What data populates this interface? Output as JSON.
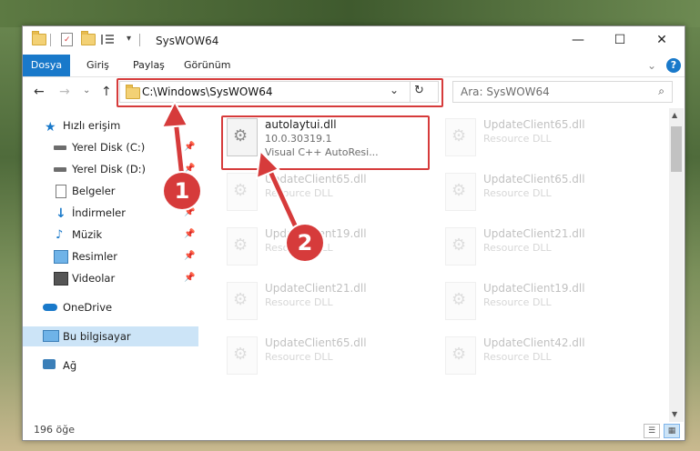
{
  "window": {
    "title": "SysWOW64",
    "controls": {
      "minimize": "—",
      "maximize": "☐",
      "close": "✕"
    }
  },
  "ribbon": {
    "tabs": [
      {
        "label": "Dosya",
        "active": true
      },
      {
        "label": "Giriş"
      },
      {
        "label": "Paylaş"
      },
      {
        "label": "Görünüm"
      }
    ],
    "collapse_glyph": "⌄",
    "help_glyph": "?"
  },
  "address_bar": {
    "path": "C:\\Windows\\SysWOW64",
    "dropdown_glyph": "⌄",
    "refresh_glyph": "↻",
    "back_glyph": "←",
    "forward_glyph": "→",
    "recent_glyph": "⌄",
    "up_glyph": "↑"
  },
  "search": {
    "placeholder": "Ara: SysWOW64",
    "icon": "search-icon"
  },
  "nav_pane": {
    "items": [
      {
        "label": "Hızlı erişim",
        "icon": "star-icon",
        "pinned": false,
        "indent": 1
      },
      {
        "label": "Yerel Disk (C:)",
        "icon": "drive-icon",
        "pinned": true,
        "indent": 2
      },
      {
        "label": "Yerel Disk (D:)",
        "icon": "drive-icon",
        "pinned": true,
        "indent": 2
      },
      {
        "label": "Belgeler",
        "icon": "documents-icon",
        "pinned": true,
        "indent": 2
      },
      {
        "label": "İndirmeler",
        "icon": "downloads-icon",
        "pinned": true,
        "indent": 2
      },
      {
        "label": "Müzik",
        "icon": "music-icon",
        "pinned": true,
        "indent": 2
      },
      {
        "label": "Resimler",
        "icon": "pictures-icon",
        "pinned": true,
        "indent": 2
      },
      {
        "label": "Videolar",
        "icon": "videos-icon",
        "pinned": true,
        "indent": 2
      },
      {
        "label": "OneDrive",
        "icon": "cloud-icon",
        "pinned": false,
        "indent": 1
      },
      {
        "label": "Bu bilgisayar",
        "icon": "computer-icon",
        "pinned": false,
        "indent": 1,
        "selected": true
      },
      {
        "label": "Ağ",
        "icon": "network-icon",
        "pinned": false,
        "indent": 1
      }
    ]
  },
  "files": [
    {
      "name": "autolaytui.dll",
      "version": "10.0.30319.1",
      "description": "Visual C++ AutoResi...",
      "faded": false
    },
    {
      "name": "UpdateClient65.dll",
      "description": "Resource DLL",
      "faded": true
    },
    {
      "name": "UpdateClient65.dll",
      "description": "Resource DLL",
      "faded": true
    },
    {
      "name": "UpdateClient65.dll",
      "description": "Resource DLL",
      "faded": true
    },
    {
      "name": "UpdateClient19.dll",
      "description": "Resource DLL",
      "faded": true
    },
    {
      "name": "UpdateClient21.dll",
      "description": "Resource DLL",
      "faded": true
    },
    {
      "name": "UpdateClient21.dll",
      "description": "Resource DLL",
      "faded": true
    },
    {
      "name": "UpdateClient19.dll",
      "description": "Resource DLL",
      "faded": true
    },
    {
      "name": "UpdateClient65.dll",
      "description": "Resource DLL",
      "faded": true
    },
    {
      "name": "UpdateClient42.dll",
      "description": "Resource DLL",
      "faded": true
    }
  ],
  "status_bar": {
    "item_count": "196 öğe"
  },
  "annotations": {
    "badge_1": "1",
    "badge_2": "2",
    "color": "#d63b3b"
  }
}
